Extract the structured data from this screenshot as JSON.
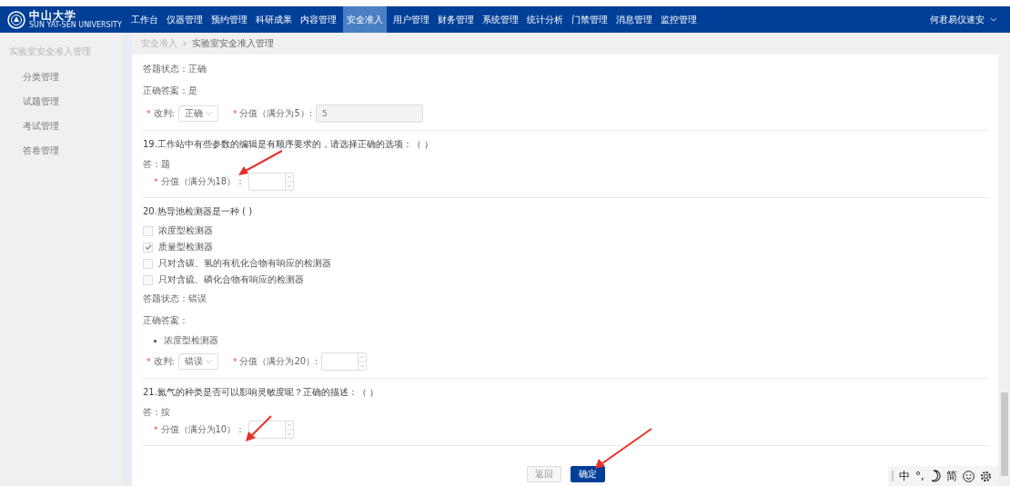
{
  "nav": {
    "logo": {
      "name": "中山大学",
      "subtitle": "SUN YAT-SEN UNIVERSITY"
    },
    "items": [
      {
        "label": "工作台",
        "selected": false
      },
      {
        "label": "仪器管理",
        "selected": false
      },
      {
        "label": "预约管理",
        "selected": false
      },
      {
        "label": "科研成果",
        "selected": false
      },
      {
        "label": "内容管理",
        "selected": false
      },
      {
        "label": "安全准入",
        "selected": true
      },
      {
        "label": "用户管理",
        "selected": false
      },
      {
        "label": "财务管理",
        "selected": false
      },
      {
        "label": "系统管理",
        "selected": false
      },
      {
        "label": "统计分析",
        "selected": false
      },
      {
        "label": "门禁管理",
        "selected": false
      },
      {
        "label": "消息管理",
        "selected": false
      },
      {
        "label": "监控管理",
        "selected": false
      }
    ],
    "user": "何君易仪速安"
  },
  "sidebar": {
    "title": "实验室安全准入管理",
    "items": [
      {
        "label": "分类管理"
      },
      {
        "label": "试题管理"
      },
      {
        "label": "考试管理"
      },
      {
        "label": "答卷管理"
      }
    ]
  },
  "breadcrumb": [
    "安全准入",
    "实验室安全准入管理"
  ],
  "rows": [
    {
      "kind": "text",
      "text": "答题状态：正确"
    },
    {
      "kind": "text",
      "text": "正确答案：是"
    },
    {
      "kind": "judge",
      "mark": "*",
      "judge_label": "改判:",
      "judge_value": "正确",
      "score_mark": "*",
      "score_label": "分值（满分为5）:",
      "score_value": "5",
      "score_disabled": true
    },
    {
      "kind": "divider"
    },
    {
      "kind": "question",
      "text": "19.工作站中有些参数的编辑是有顺序要求的，请选择正确的选项：（ ）"
    },
    {
      "kind": "answer",
      "text": "答：题"
    },
    {
      "kind": "score",
      "mark": "*",
      "label": "分值（满分为18）："
    },
    {
      "kind": "divider"
    },
    {
      "kind": "question",
      "text": "20.热导池检测器是一种 ( )"
    },
    {
      "kind": "option",
      "label": "浓度型检测器",
      "checked": false
    },
    {
      "kind": "option",
      "label": "质量型检测器",
      "checked": true
    },
    {
      "kind": "option",
      "label": "只对含碳、氢的有机化合物有响应的检测器",
      "checked": false
    },
    {
      "kind": "option",
      "label": "只对含硫、磷化合物有响应的检测器",
      "checked": false
    },
    {
      "kind": "text",
      "text": "答题状态：错误"
    },
    {
      "kind": "text",
      "text": "正确答案："
    },
    {
      "kind": "bullet",
      "text": "浓度型检测器"
    },
    {
      "kind": "judge",
      "mark": "*",
      "judge_label": "改判:",
      "judge_value": "错误",
      "score_mark": "*",
      "score_label": "分值（满分为20）:",
      "score_disabled": false
    },
    {
      "kind": "divider"
    },
    {
      "kind": "question",
      "text": "21.氦气的种类是否可以影响灵敏度呢？正确的描述：（ ）"
    },
    {
      "kind": "answer",
      "text": "答：按"
    },
    {
      "kind": "score",
      "mark": "*",
      "label": "分值（满分为10）："
    },
    {
      "kind": "divider"
    }
  ],
  "buttons": [
    {
      "label": "返回",
      "kind": "secondary"
    },
    {
      "label": "确定",
      "kind": "primary"
    }
  ],
  "ime": {
    "items": [
      "中",
      "°,",
      "简"
    ]
  }
}
